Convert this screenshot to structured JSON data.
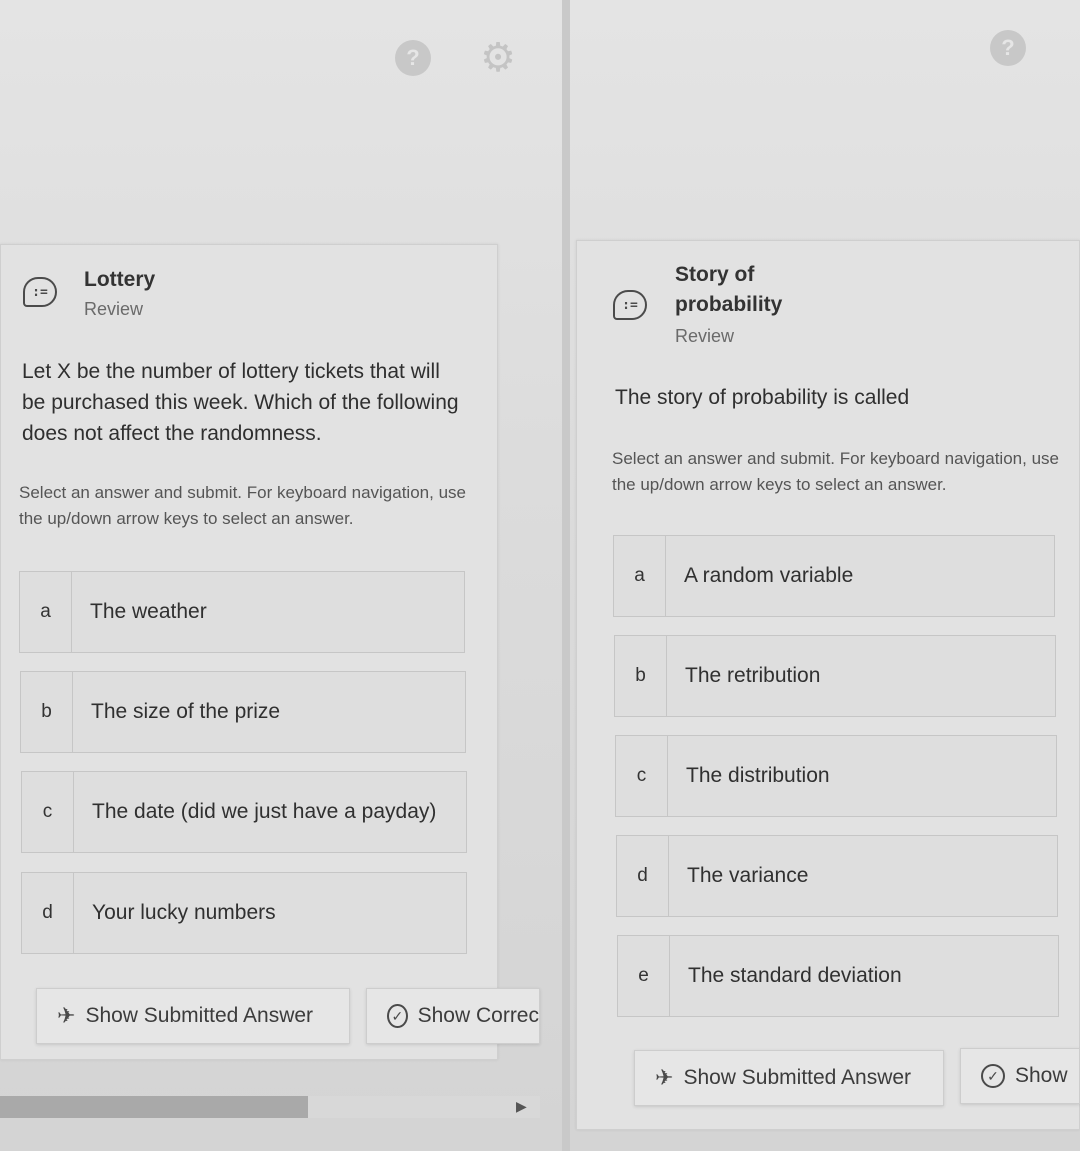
{
  "left": {
    "title": "Lottery",
    "subtitle": "Review",
    "header_icon": ":=",
    "question": "Let X be the number of lottery tickets that will be purchased this week. Which of the following does not affect the randomness.",
    "instructions": "Select an answer and submit. For keyboard navigation, use the up/down arrow keys to select an answer.",
    "options": [
      {
        "letter": "a",
        "text": "The weather"
      },
      {
        "letter": "b",
        "text": "The size of the prize"
      },
      {
        "letter": "c",
        "text": "The date (did we just have a payday)"
      },
      {
        "letter": "d",
        "text": "Your lucky numbers"
      }
    ],
    "buttons": {
      "show_submitted": "Show Submitted Answer",
      "show_correct": "Show Correc"
    },
    "top_icons": {
      "help": "help-icon",
      "settings": "gear-icon"
    }
  },
  "right": {
    "title_line1": "Story of",
    "title_line2": "probability",
    "subtitle": "Review",
    "header_icon": ":=",
    "question": "The story of probability is called",
    "instructions": "Select an answer and submit. For keyboard navigation, use the up/down arrow keys to select an answer.",
    "options": [
      {
        "letter": "a",
        "text": "A random variable"
      },
      {
        "letter": "b",
        "text": "The retribution"
      },
      {
        "letter": "c",
        "text": "The distribution"
      },
      {
        "letter": "d",
        "text": "The variance"
      },
      {
        "letter": "e",
        "text": "The standard deviation"
      }
    ],
    "buttons": {
      "show_submitted": "Show Submitted Answer",
      "show_correct": "Show"
    },
    "top_icons": {
      "help": "help-icon"
    }
  },
  "icons": {
    "help_glyph": "?",
    "gear_glyph": "⚙",
    "plane_glyph": "✈",
    "check_glyph": "✓",
    "arrow_glyph": "▶"
  }
}
